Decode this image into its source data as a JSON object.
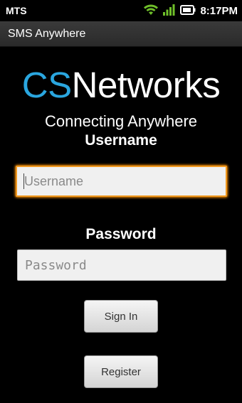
{
  "status_bar": {
    "carrier": "MTS",
    "time": "8:17PM",
    "icons": [
      "wifi-icon",
      "signal-icon",
      "battery-icon"
    ]
  },
  "app": {
    "title": "SMS Anywhere"
  },
  "logo": {
    "part1": "CS",
    "part2": "Networks",
    "accent_color": "#2aa6df"
  },
  "tagline": "Connecting Anywhere",
  "form": {
    "username_label": "Username",
    "username_placeholder": "Username",
    "username_value": "",
    "password_label": "Password",
    "password_placeholder": "Password",
    "password_value": "",
    "signin_label": "Sign In",
    "register_label": "Register",
    "focus_color": "#f0981f"
  }
}
